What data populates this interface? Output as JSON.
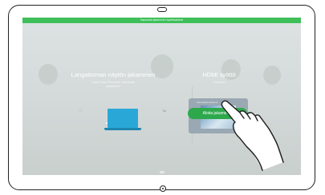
{
  "banner": {
    "text": "Napsauta jakaminen lopettaaksesi"
  },
  "left_panel": {
    "title": "Langattoman näytön jakaminen",
    "subtitle": "Käytä Cisco Proximity -sovellusta jakaaksesi",
    "label": "Tai"
  },
  "right_panel": {
    "title": "HDMI syöttö",
    "subtitle": "Liitä johto",
    "card_label": "Kannettava tietokone",
    "button_label": "Aloita jakaminen"
  },
  "colors": {
    "accent": "#3fbf5a",
    "button": "#2ea84c",
    "laptop": "#29a8d8"
  },
  "icons": {
    "camera": "camera-icon",
    "home": "home-button-icon",
    "hand": "hand-pointer-icon",
    "laptop": "laptop-icon"
  }
}
